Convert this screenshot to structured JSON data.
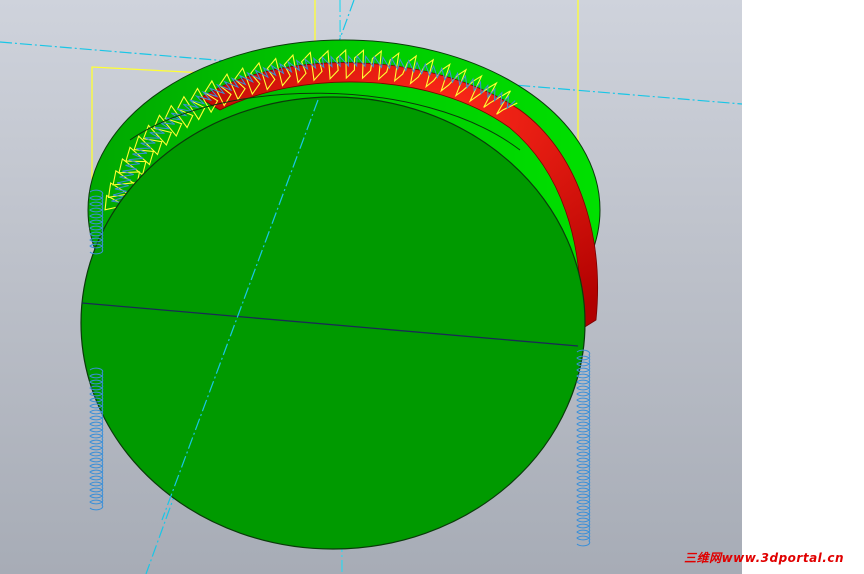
{
  "watermark": {
    "text": "三维网www.3dportal.cn"
  },
  "colors": {
    "viewport_top": "#cfd3dc",
    "viewport_bottom": "#a7acb6",
    "part_face": "#009a00",
    "part_side": "#00c400",
    "part_edge": "#0b3a0b",
    "cut_surface": "#d40000",
    "toolpath_yellow": "#ffff33",
    "toolpath_blue": "#3a8fd8",
    "axis_cyan": "#19c6e6",
    "watermark": "#e00000",
    "page_bg": "#ffffff"
  },
  "icons": {
    "part": "cylinder-part-icon",
    "toolpath": "helical-toolpath-icon"
  }
}
